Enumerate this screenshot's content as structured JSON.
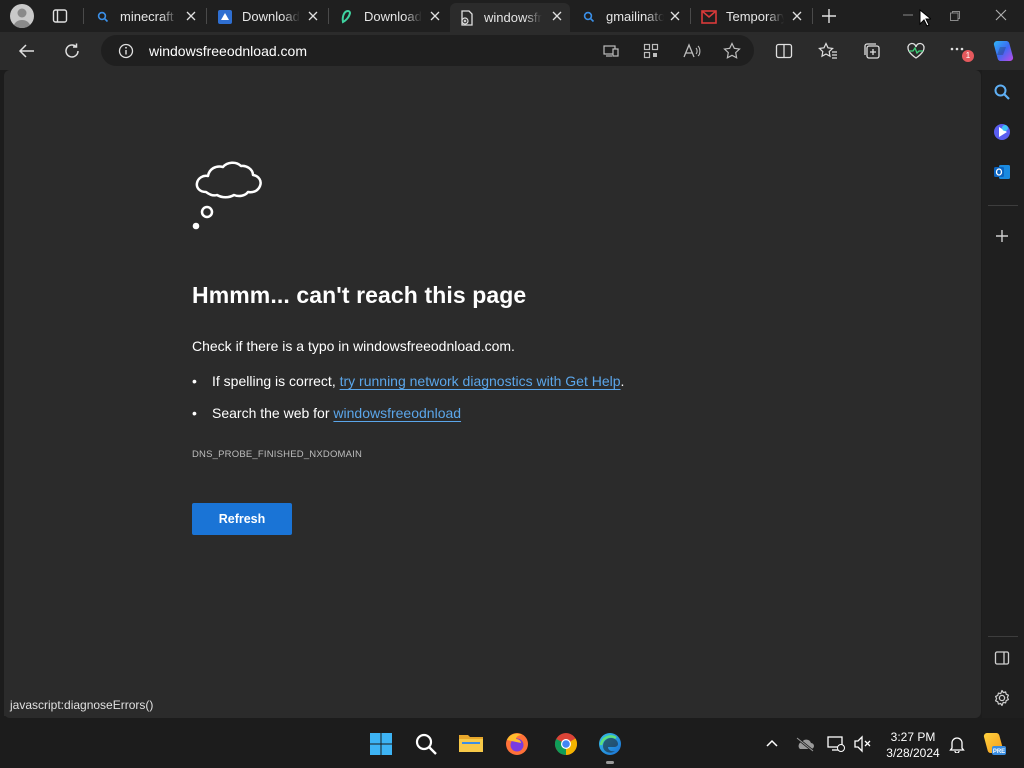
{
  "browser": {
    "tabs": [
      {
        "title": "minecraft f",
        "icon": "search-icon"
      },
      {
        "title": "Download",
        "icon": "download-site-icon"
      },
      {
        "title": "Download",
        "icon": "uptodown-icon"
      },
      {
        "title": "windowsfr",
        "icon": "broken-page-icon",
        "active": true
      },
      {
        "title": "gmailinato",
        "icon": "search-icon"
      },
      {
        "title": "Temporary",
        "icon": "mail-icon"
      }
    ],
    "url": "windowsfreeodnload.com",
    "more_badge": "1"
  },
  "error_page": {
    "headline": "Hmmm... can't reach this page",
    "check_text": "Check if there is a typo in windowsfreeodnload.com.",
    "bullet1_prefix": "If spelling is correct, ",
    "bullet1_link": "try running network diagnostics with Get Help",
    "bullet1_suffix": ".",
    "bullet2_prefix": "Search the web for ",
    "bullet2_link": "windowsfreeodnload",
    "error_code": "DNS_PROBE_FINISHED_NXDOMAIN",
    "refresh_label": "Refresh"
  },
  "status_bar": {
    "text": "javascript:diagnoseErrors()"
  },
  "taskbar": {
    "time": "3:27 PM",
    "date": "3/28/2024"
  },
  "colors": {
    "accent_button": "#1a74d6",
    "link": "#5ba6ea",
    "page_bg": "#2b2b2b"
  }
}
